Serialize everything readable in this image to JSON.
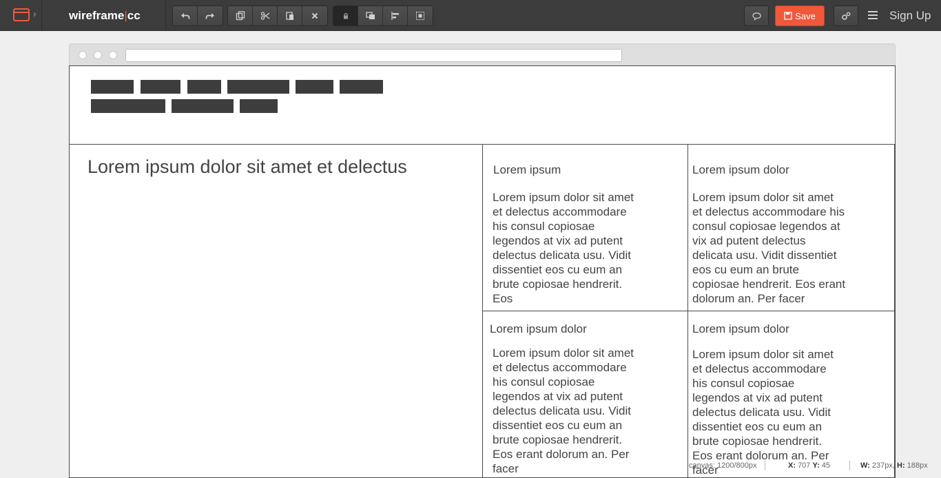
{
  "app": {
    "brand_left": "wireframe",
    "brand_sep": "|",
    "brand_right": "cc",
    "save_label": "Save",
    "signup_label": "Sign Up",
    "accent_color": "#f0583a",
    "toolbar_icons": [
      "undo-icon",
      "redo-icon",
      "duplicate-icon",
      "cut-icon",
      "paste-icon",
      "delete-icon",
      "lock-icon",
      "arrange-icon",
      "align-icon",
      "group-icon",
      "comment-icon",
      "save-icon",
      "settings-icon",
      "menu-icon"
    ]
  },
  "canvas": {
    "hero_title": "Lorem ipsum dolor sit amet et delectus",
    "cells": [
      {
        "title": "Lorem ipsum",
        "lines": [
          "Lorem ipsum dolor sit amet",
          "et delectus accommodare",
          "his consul copiosae",
          "legendos at vix ad putent",
          "delectus delicata usu. Vidit",
          "dissentiet eos cu eum an",
          "brute copiosae hendrerit.",
          "Eos"
        ]
      },
      {
        "title": "Lorem ipsum dolor",
        "lines": [
          "Lorem ipsum dolor sit amet",
          "et delectus accommodare his",
          "consul copiosae legendos at",
          "vix ad putent delectus",
          "delicata usu. Vidit dissentiet",
          "eos cu eum an brute",
          "copiosae hendrerit. Eos erant",
          "dolorum an. Per facer"
        ]
      },
      {
        "title": "Lorem ipsum dolor",
        "lines": [
          "Lorem ipsum dolor sit amet",
          "et delectus accommodare",
          "his consul copiosae",
          "legendos at vix ad putent",
          "delectus delicata usu. Vidit",
          "dissentiet eos cu eum an",
          "brute copiosae hendrerit.",
          "Eos erant dolorum an. Per",
          "facer"
        ]
      },
      {
        "title": "Lorem ipsum dolor",
        "lines": [
          "Lorem ipsum dolor sit amet",
          "et delectus accommodare",
          "his consul copiosae",
          "legendos at vix ad putent",
          "delectus delicata usu. Vidit",
          "dissentiet eos cu eum an",
          "brute copiosae hendrerit.",
          "Eos erant dolorum an. Per",
          "facer"
        ]
      }
    ]
  },
  "status": {
    "canvas_label": "canvas:",
    "canvas_value": "1200/800px",
    "x_label": "X:",
    "x_value": "707",
    "y_label": "Y:",
    "y_value": "45",
    "w_label": "W:",
    "w_value": "237px,",
    "h_label": "H:",
    "h_value": "188px"
  }
}
